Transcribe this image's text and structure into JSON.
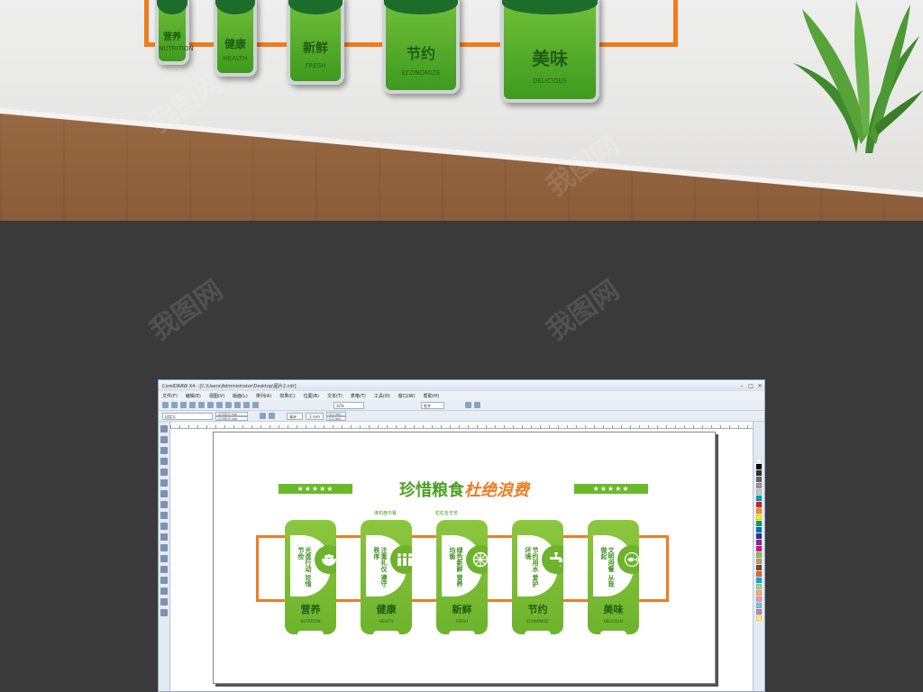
{
  "photo": {
    "wall_cards": [
      {
        "cn": "营养",
        "en": "NUTRITION"
      },
      {
        "cn": "健康",
        "en": "HEALTH"
      },
      {
        "cn": "新鲜",
        "en": "FRESH"
      },
      {
        "cn": "节约",
        "en": "ECONOMIZE"
      },
      {
        "cn": "美味",
        "en": "DELICIOUS"
      }
    ]
  },
  "watermark": "我图网",
  "window": {
    "title": "CorelDRAW X4 - [C:\\Users\\Administrator\\Desktop\\图片2.cdr]",
    "menu": [
      "文件(F)",
      "编辑(E)",
      "视图(V)",
      "版面(L)",
      "排列(A)",
      "效果(C)",
      "位图(B)",
      "文本(T)",
      "表格(T)",
      "工具(O)",
      "窗口(W)",
      "帮助(H)"
    ],
    "toolbar": {
      "zoom": "32%",
      "snap": "贴齐",
      "paper": "自定义",
      "width": "4,000.0 mm",
      "height": "2,000.0 mm",
      "units": "毫米",
      "nudge": ".1 mm",
      "dup_x": "5.0 mm",
      "dup_y": "5.0 mm"
    },
    "colors": {
      "green": "#6ab92a",
      "dark_green": "#1f6e37",
      "orange": "#ef7d22"
    }
  },
  "design": {
    "stars_left": "★★★★★",
    "stars_right": "★★★★★",
    "heading_green": "珍惜粮食",
    "heading_orange": "杜绝浪费",
    "sub_left": "谁知盘中餐",
    "sub_right": "粒粒皆辛苦",
    "cards": [
      {
        "vtext": "光盘行动 珍惜节俭",
        "cn": "营养",
        "en": "NUTRITION",
        "icon": "bowl-icon"
      },
      {
        "vtext": "注重礼仪 遵守秩序",
        "cn": "健康",
        "en": "HEALTH",
        "icon": "people-icon"
      },
      {
        "vtext": "绿色新鲜 营养均衡",
        "cn": "新鲜",
        "en": "FRESH",
        "icon": "lime-icon"
      },
      {
        "vtext": "节约用水 爱护环境",
        "cn": "节约",
        "en": "ECONOMIZE",
        "icon": "faucet-icon"
      },
      {
        "vtext": "文明用餐 从我做起",
        "cn": "美味",
        "en": "DELICIOUS",
        "icon": "fish-icon"
      }
    ]
  }
}
